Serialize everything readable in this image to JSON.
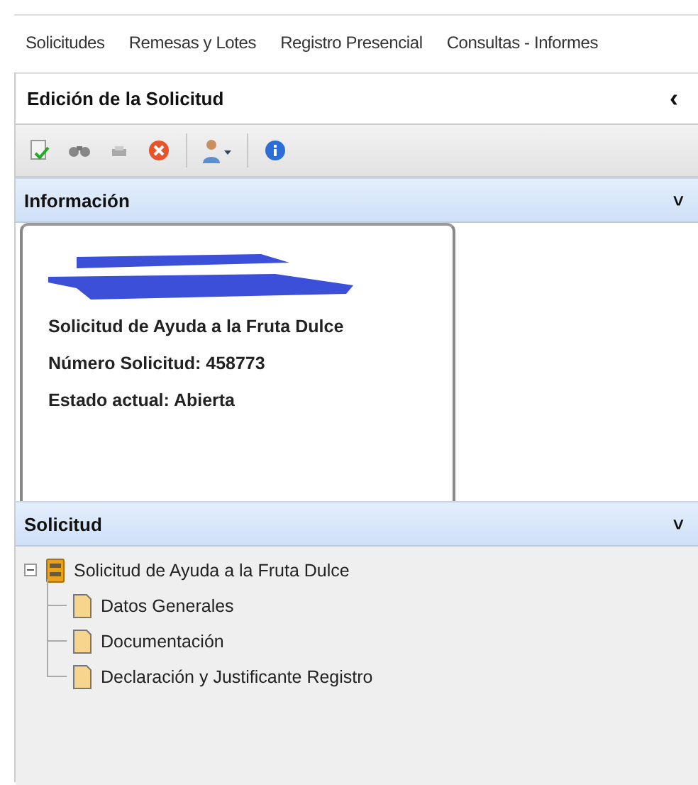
{
  "menu": [
    "Solicitudes",
    "Remesas y Lotes",
    "Registro Presencial",
    "Consultas - Informes"
  ],
  "panel": {
    "title": "Edición de la Solicitud",
    "collapse_glyph": "‹"
  },
  "toolbar": [
    {
      "kind": "check-doc"
    },
    {
      "kind": "binoculars"
    },
    {
      "kind": "printer"
    },
    {
      "kind": "cancel"
    },
    {
      "kind": "separator"
    },
    {
      "kind": "user-menu"
    },
    {
      "kind": "separator"
    },
    {
      "kind": "info"
    }
  ],
  "info_section": {
    "title": "Información",
    "expand_glyph": "˅",
    "lines": [
      "Solicitud de Ayuda a la Fruta Dulce",
      "Número Solicitud: 458773",
      "Estado actual: Abierta"
    ]
  },
  "request_section": {
    "title": "Solicitud",
    "expand_glyph": "˅",
    "tree": [
      {
        "label": "Solicitud de Ayuda a la Fruta Dulce",
        "kind": "folder",
        "expanded": true,
        "children": [
          {
            "label": "Datos Generales",
            "kind": "page"
          },
          {
            "label": "Documentación",
            "kind": "page"
          },
          {
            "label": "Declaración y Justificante Registro",
            "kind": "page"
          }
        ]
      }
    ]
  }
}
